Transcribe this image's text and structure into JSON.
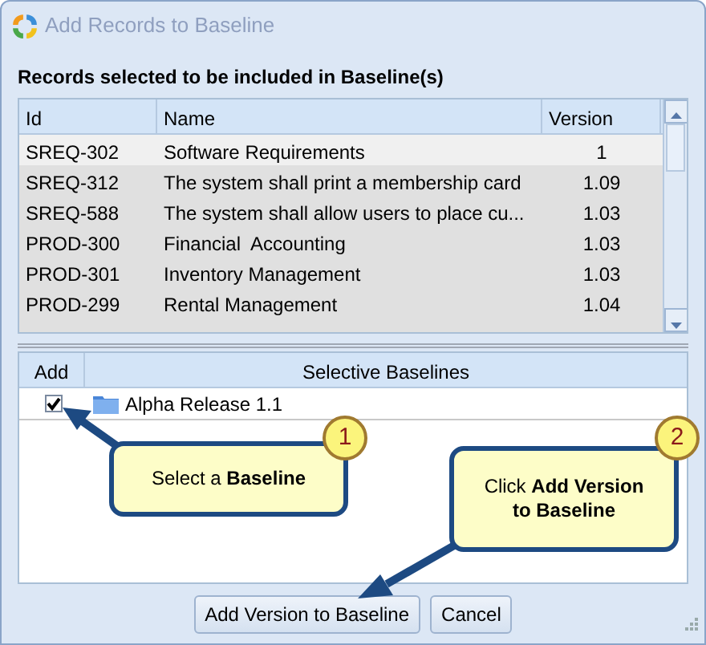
{
  "window": {
    "title": "Add Records to Baseline"
  },
  "records": {
    "label": "Records selected to be included in Baseline(s)",
    "columns": [
      "Id",
      "Name",
      "Version"
    ],
    "rows": [
      {
        "id": "SREQ-302",
        "name": "Software Requirements",
        "version": "1",
        "selected": false
      },
      {
        "id": "SREQ-312",
        "name": "The system shall print a membership card",
        "version": "1.09",
        "selected": true
      },
      {
        "id": "SREQ-588",
        "name": "The system shall allow users to place cu...",
        "version": "1.03",
        "selected": true
      },
      {
        "id": "PROD-300",
        "name": "Financial  Accounting",
        "version": "1.03",
        "selected": true
      },
      {
        "id": "PROD-301",
        "name": "Inventory Management",
        "version": "1.03",
        "selected": true
      },
      {
        "id": "PROD-299",
        "name": "Rental Management",
        "version": "1.04",
        "selected": true
      }
    ]
  },
  "baselines": {
    "columns": [
      "Add",
      "Selective Baselines"
    ],
    "rows": [
      {
        "name": "Alpha Release 1.1",
        "checked": true
      }
    ]
  },
  "callouts": [
    {
      "number": "1",
      "text": "Select a **Baseline**"
    },
    {
      "number": "2",
      "text": "Click **Add Version to Baseline**"
    }
  ],
  "buttons": [
    "Add Version to Baseline",
    "Cancel"
  ]
}
